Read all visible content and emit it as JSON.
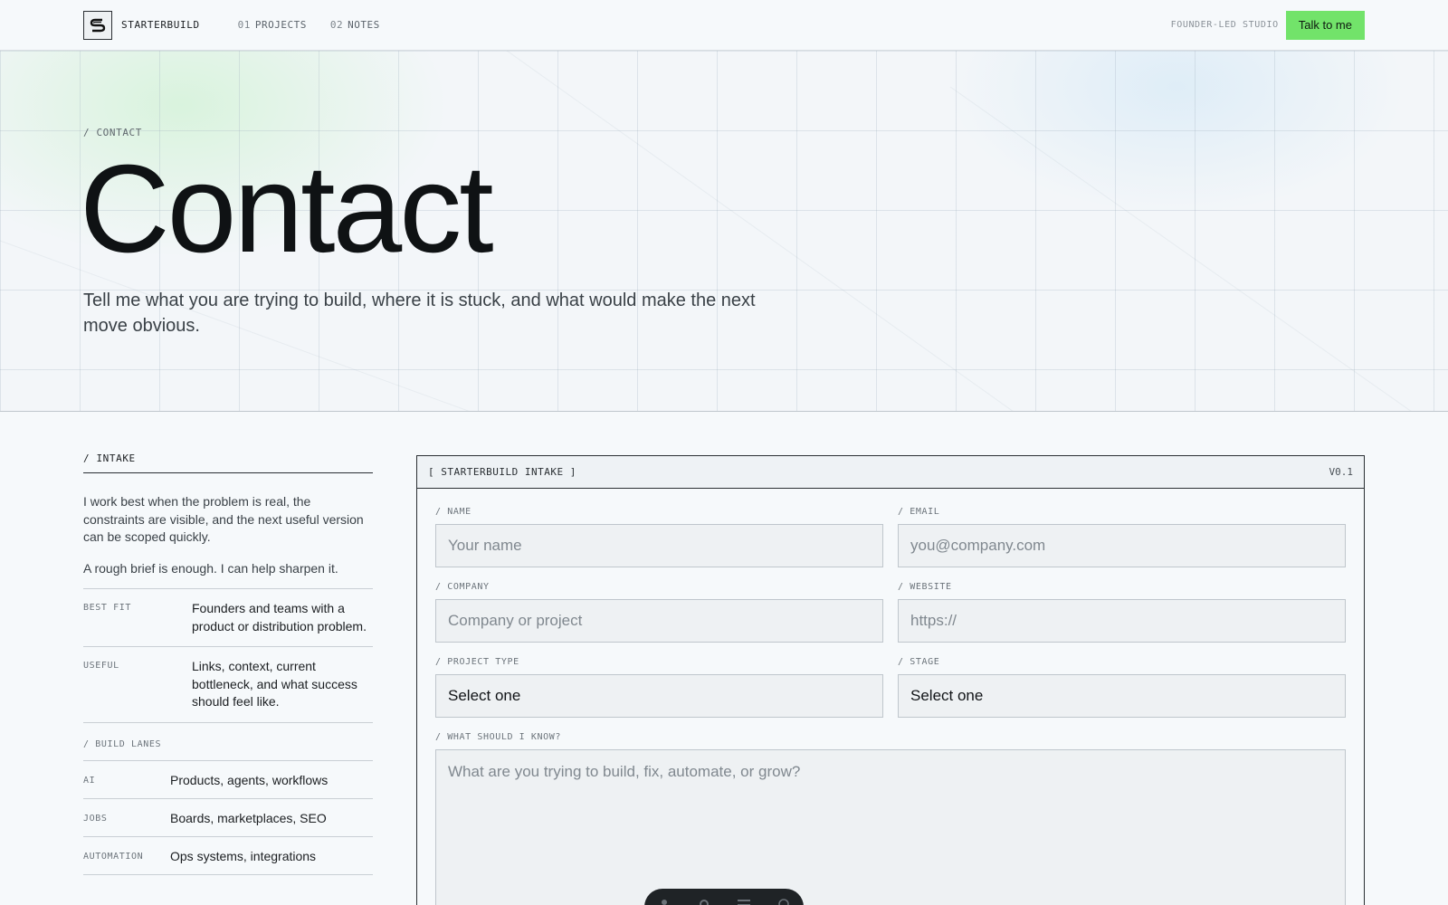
{
  "nav": {
    "brand": "STARTERBUILD",
    "links": [
      {
        "num": "01",
        "label": "PROJECTS"
      },
      {
        "num": "02",
        "label": "NOTES"
      }
    ],
    "tagline": "FOUNDER-LED STUDIO",
    "cta": "Talk to me",
    "accent": "#72e36a"
  },
  "hero": {
    "crumb": "/ CONTACT",
    "title": "Contact",
    "subtitle": "Tell me what you are trying to build, where it is stuck, and what would make the next move obvious."
  },
  "intake": {
    "heading": "/ INTAKE",
    "intro": "I work best when the problem is real, the constraints are visible, and the next useful version can be scoped quickly.",
    "intro2": "A rough brief is enough. I can help sharpen it.",
    "facts": [
      {
        "key": "BEST FIT",
        "value": "Founders and teams with a product or distribution problem."
      },
      {
        "key": "USEFUL",
        "value": "Links, context, current bottleneck, and what success should feel like."
      }
    ],
    "lanes_heading": "/ BUILD LANES",
    "lanes": [
      {
        "key": "AI",
        "value": "Products, agents, workflows"
      },
      {
        "key": "JOBS",
        "value": "Boards, marketplaces, SEO"
      },
      {
        "key": "AUTOMATION",
        "value": "Ops systems, integrations"
      }
    ]
  },
  "form": {
    "title": "[ STARTERBUILD INTAKE ]",
    "version": "V0.1",
    "name_label": "/ NAME",
    "name_placeholder": "Your name",
    "email_label": "/ EMAIL",
    "email_placeholder": "you@company.com",
    "company_label": "/ COMPANY",
    "company_placeholder": "Company or project",
    "website_label": "/ WEBSITE",
    "website_placeholder": "https://",
    "type_label": "/ PROJECT TYPE",
    "type_value": "Select one",
    "stage_label": "/ STAGE",
    "stage_value": "Select one",
    "know_label": "/ WHAT SHOULD I KNOW?",
    "know_placeholder": "What are you trying to build, fix, automate, or grow?"
  }
}
